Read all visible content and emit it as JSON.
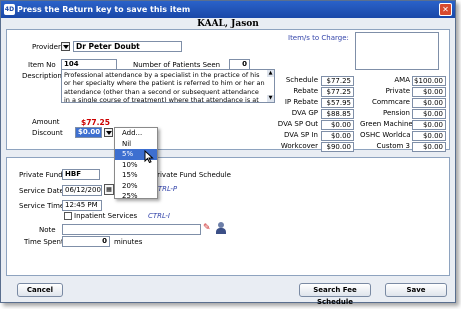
{
  "title": "Press the Return key to save this item",
  "app_icon": "4D",
  "patient_name": "KAAL, Jason",
  "provider": {
    "label": "Provider",
    "value": "Dr Peter Doubt"
  },
  "item_no": {
    "label": "Item No",
    "value": "104"
  },
  "patients_seen": {
    "label": "Number of Patients Seen",
    "value": "0"
  },
  "item_charge_link": "Item/s to Charge:",
  "description": {
    "label": "Description",
    "value": "Professional attendance by a specialist in the practice of his or her specialty where the patient is referred to him or her  an attendance (other than a second or subsequent attendance in a single course of treatment) where that attendance is at consulting rooms or hospital,"
  },
  "amount": {
    "label": "Amount",
    "value": "$77.25"
  },
  "discount": {
    "label": "Discount",
    "value": "$0.00"
  },
  "schedule_left": [
    {
      "label": "Schedule",
      "value": "$77.25"
    },
    {
      "label": "Rebate",
      "value": "$77.25"
    },
    {
      "label": "IP Rebate",
      "value": "$57.95"
    },
    {
      "label": "DVA GP",
      "value": "$88.85"
    },
    {
      "label": "DVA SP Out",
      "value": "$0.00"
    },
    {
      "label": "DVA SP In",
      "value": "$0.00"
    },
    {
      "label": "Workcover",
      "value": "$90.00"
    }
  ],
  "schedule_right": [
    {
      "label": "AMA",
      "value": "$100.00"
    },
    {
      "label": "Private",
      "value": "$0.00"
    },
    {
      "label": "Commcare",
      "value": "$0.00"
    },
    {
      "label": "Pension",
      "value": "$0.00"
    },
    {
      "label": "Green Machine",
      "value": "$0.00"
    },
    {
      "label": "OSHC Worldca",
      "value": "$0.00"
    },
    {
      "label": "Custom 3",
      "value": "$0.00"
    }
  ],
  "discount_menu": [
    "Add...",
    "Nil",
    "5%",
    "10%",
    "15%",
    "20%",
    "25%"
  ],
  "discount_menu_selected": "5%",
  "private_fund": {
    "label": "Private Fund",
    "value": "HBF",
    "schedule_label": "Private Fund Schedule"
  },
  "service_date": {
    "label": "Service Date",
    "value": "06/12/2007",
    "shortcut": "CTRL-P"
  },
  "service_time": {
    "label": "Service Time",
    "value": "12:45 PM"
  },
  "inpatient": {
    "label": "Inpatient Services",
    "shortcut": "CTRL-I"
  },
  "note": {
    "label": "Note",
    "value": ""
  },
  "time_spent": {
    "label": "Time Spent",
    "value": "0",
    "unit": "minutes"
  },
  "buttons": {
    "cancel": "Cancel",
    "search": "Search Fee Schedule",
    "save": "Save"
  },
  "colors": {
    "title_bar": "#1a48a8",
    "amount": "#cc0000",
    "link": "#3344aa",
    "menu_highlight": "#3d6fd0"
  }
}
